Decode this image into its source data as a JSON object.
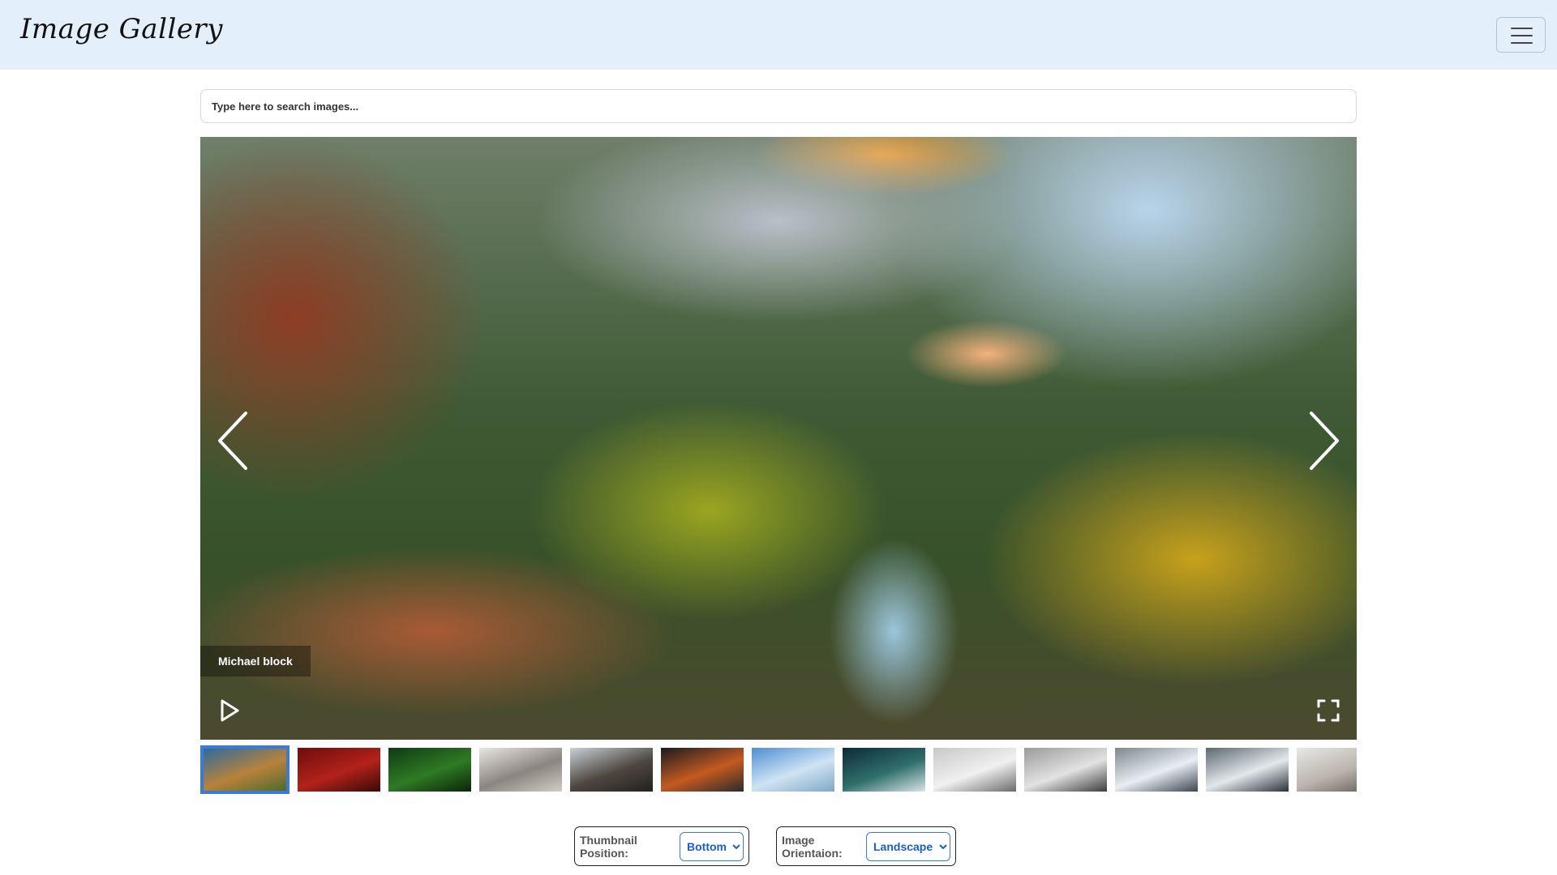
{
  "header": {
    "brand": "Image Gallery",
    "menu_icon": "hamburger-icon"
  },
  "search": {
    "placeholder": "Type here to search images..."
  },
  "viewer": {
    "caption": "Michael block",
    "prev_icon": "chevron-left-icon",
    "next_icon": "chevron-right-icon",
    "play_icon": "play-icon",
    "fullscreen_icon": "fullscreen-icon"
  },
  "thumbnails": [
    {
      "active": true,
      "colors": [
        "#2f6a9e",
        "#b8823a",
        "#4f6a2c"
      ]
    },
    {
      "active": false,
      "colors": [
        "#6e0d0d",
        "#b3211a",
        "#3a0a08"
      ]
    },
    {
      "active": false,
      "colors": [
        "#0f3b12",
        "#2f7a25",
        "#0a2509"
      ]
    },
    {
      "active": false,
      "colors": [
        "#e9e6e2",
        "#8b8580",
        "#d1ccc6"
      ]
    },
    {
      "active": false,
      "colors": [
        "#c9d0d6",
        "#4d4740",
        "#22201d"
      ]
    },
    {
      "active": false,
      "colors": [
        "#1a1a1f",
        "#c45a20",
        "#2d2a2a"
      ]
    },
    {
      "active": false,
      "colors": [
        "#4d8fd3",
        "#cfe3f3",
        "#7fa8c7"
      ]
    },
    {
      "active": false,
      "colors": [
        "#0c2a3a",
        "#2f6f6a",
        "#d9e4ea"
      ]
    },
    {
      "active": false,
      "colors": [
        "#c8c8c8",
        "#f0f0f0",
        "#6b6b6b"
      ]
    },
    {
      "active": false,
      "colors": [
        "#9a9a9a",
        "#e2e2e2",
        "#3c3c3c"
      ]
    },
    {
      "active": false,
      "colors": [
        "#7c8790",
        "#e8eef2",
        "#3b4650"
      ]
    },
    {
      "active": false,
      "colors": [
        "#5b6770",
        "#e4e8eb",
        "#2a3138"
      ]
    },
    {
      "active": false,
      "colors": [
        "#e8e8e8",
        "#b9b3ac",
        "#5e5852"
      ]
    }
  ],
  "settings": {
    "thumbnail_position_label": "Thumbnail Position:",
    "thumbnail_position_value": "Bottom",
    "image_orientation_label": "Image Orientaion:",
    "image_orientation_value": "Landscape"
  }
}
